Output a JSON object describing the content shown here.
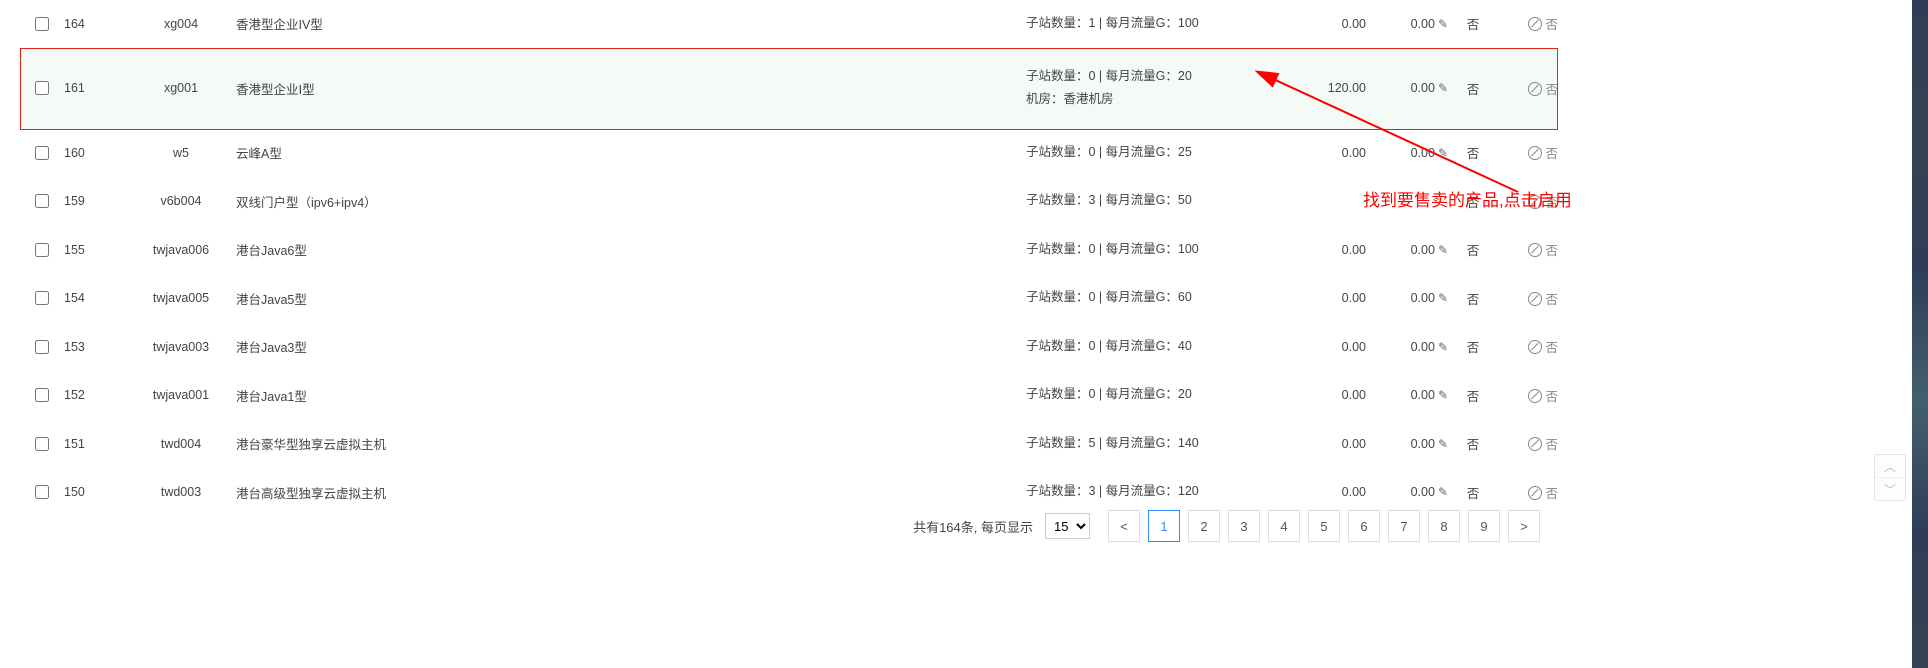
{
  "labels": {
    "sub_prefix": "子站数量：",
    "traffic_prefix": " | 每月流量G：",
    "room_prefix": "机房：",
    "no": "否",
    "callout": "找到要售卖的产品,点击启用",
    "pager_summary": "共有164条, 每页显示",
    "per_page": "15",
    "prev": "<",
    "next": ">"
  },
  "pages": [
    "1",
    "2",
    "3",
    "4",
    "5",
    "6",
    "7",
    "8",
    "9"
  ],
  "current_page": "1",
  "rows": [
    {
      "id": "164",
      "code": "xg004",
      "name": "香港型企业IV型",
      "sub": "1",
      "traffic": "100",
      "room": "",
      "p1": "0.00",
      "p2": "0.00",
      "highlight": false
    },
    {
      "id": "161",
      "code": "xg001",
      "name": "香港型企业Ⅰ型",
      "sub": "0",
      "traffic": "20",
      "room": "香港机房",
      "p1": "120.00",
      "p2": "0.00",
      "highlight": true
    },
    {
      "id": "160",
      "code": "w5",
      "name": "云峰A型",
      "sub": "0",
      "traffic": "25",
      "room": "",
      "p1": "0.00",
      "p2": "0.00",
      "highlight": false
    },
    {
      "id": "159",
      "code": "v6b004",
      "name": "双线门户型（ipv6+ipv4）",
      "sub": "3",
      "traffic": "50",
      "room": "",
      "p1": "",
      "p2": "",
      "highlight": false
    },
    {
      "id": "155",
      "code": "twjava006",
      "name": "港台Java6型",
      "sub": "0",
      "traffic": "100",
      "room": "",
      "p1": "0.00",
      "p2": "0.00",
      "highlight": false
    },
    {
      "id": "154",
      "code": "twjava005",
      "name": "港台Java5型",
      "sub": "0",
      "traffic": "60",
      "room": "",
      "p1": "0.00",
      "p2": "0.00",
      "highlight": false
    },
    {
      "id": "153",
      "code": "twjava003",
      "name": "港台Java3型",
      "sub": "0",
      "traffic": "40",
      "room": "",
      "p1": "0.00",
      "p2": "0.00",
      "highlight": false
    },
    {
      "id": "152",
      "code": "twjava001",
      "name": "港台Java1型",
      "sub": "0",
      "traffic": "20",
      "room": "",
      "p1": "0.00",
      "p2": "0.00",
      "highlight": false
    },
    {
      "id": "151",
      "code": "twd004",
      "name": "港台豪华型独享云虚拟主机",
      "sub": "5",
      "traffic": "140",
      "room": "",
      "p1": "0.00",
      "p2": "0.00",
      "highlight": false
    },
    {
      "id": "150",
      "code": "twd003",
      "name": "港台高级型独享云虚拟主机",
      "sub": "3",
      "traffic": "120",
      "room": "",
      "p1": "0.00",
      "p2": "0.00",
      "highlight": false
    }
  ]
}
